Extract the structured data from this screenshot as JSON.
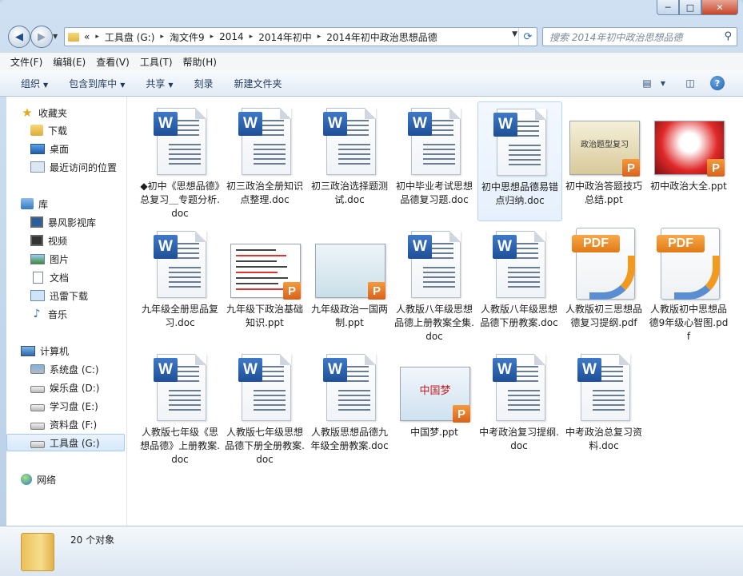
{
  "window": {
    "controls": {
      "minimize": "─",
      "maximize": "□",
      "close": "✕"
    }
  },
  "address": {
    "prefix": "«",
    "crumbs": [
      "工具盘 (G:)",
      "淘文件9",
      "2014",
      "2014年初中",
      "2014年初中政治思想品德"
    ],
    "search_placeholder": "搜索 2014年初中政治思想品德"
  },
  "menu": [
    "文件(F)",
    "编辑(E)",
    "查看(V)",
    "工具(T)",
    "帮助(H)"
  ],
  "toolbar": {
    "organize": "组织",
    "include_library": "包含到库中",
    "share": "共享",
    "burn": "刻录",
    "new_folder": "新建文件夹",
    "help": "?"
  },
  "sidebar": {
    "favorites": "收藏夹",
    "fav_items": [
      "下载",
      "桌面",
      "最近访问的位置"
    ],
    "libraries": "库",
    "lib_items": [
      "暴风影视库",
      "视频",
      "图片",
      "文档",
      "迅雷下载",
      "音乐"
    ],
    "computer": "计算机",
    "drives": [
      "系统盘 (C:)",
      "娱乐盘 (D:)",
      "学习盘 (E:)",
      "资料盘 (F:)",
      "工具盘 (G:)"
    ],
    "network": "网络"
  },
  "files": [
    {
      "name": "◆初中《思想品德》总复习＿专题分析.doc",
      "type": "doc"
    },
    {
      "name": "初三政治全册知识点整理.doc",
      "type": "doc"
    },
    {
      "name": "初三政治选择题测试.doc",
      "type": "doc"
    },
    {
      "name": "初中毕业考试思想品德复习题.doc",
      "type": "doc"
    },
    {
      "name": "初中思想品德易错点归纳.doc",
      "type": "doc"
    },
    {
      "name": "初中政治答题技巧总结.ppt",
      "type": "ppt",
      "slide_text": "政治题型复习"
    },
    {
      "name": "初中政治大全.ppt",
      "type": "ppt"
    },
    {
      "name": "九年级全册思品复习.doc",
      "type": "doc"
    },
    {
      "name": "九年级下政治基础知识.ppt",
      "type": "ppt"
    },
    {
      "name": "九年级政治一国两制.ppt",
      "type": "ppt"
    },
    {
      "name": "人教版八年级思想品德上册教案全集.doc",
      "type": "doc"
    },
    {
      "name": "人教版八年级思想品德下册教案.doc",
      "type": "doc"
    },
    {
      "name": "人教版初三思想品德复习提纲.pdf",
      "type": "pdf"
    },
    {
      "name": "人教版初中思想品德9年级心智图.pdf",
      "type": "pdf"
    },
    {
      "name": "人教版七年级《思想品德》上册教案.doc",
      "type": "doc"
    },
    {
      "name": "人教版七年级思想品德下册全册教案.doc",
      "type": "doc"
    },
    {
      "name": "人教版思想品德九年级全册教案.doc",
      "type": "doc"
    },
    {
      "name": "中国梦.ppt",
      "type": "ppt",
      "slide_text": "中国梦"
    },
    {
      "name": "中考政治复习提纲.doc",
      "type": "doc"
    },
    {
      "name": "中考政治总复习资料.doc",
      "type": "doc"
    }
  ],
  "badges": {
    "word": "W",
    "ppt": "P",
    "pdf": "PDF"
  },
  "status": {
    "count": "20 个对象"
  }
}
